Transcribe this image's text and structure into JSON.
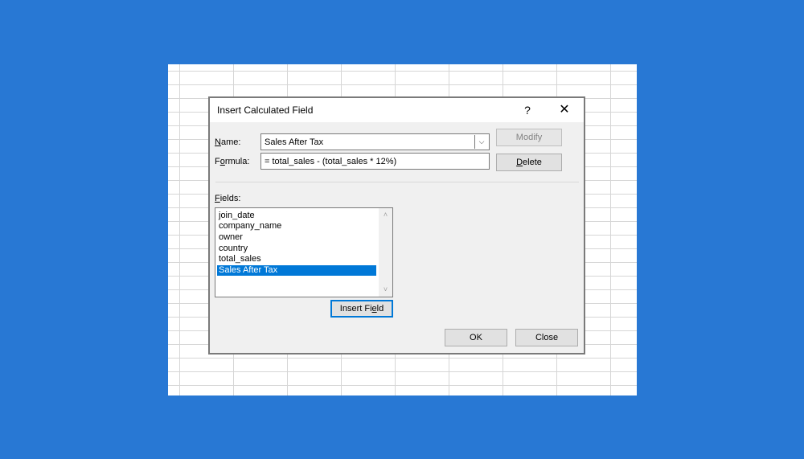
{
  "dialog": {
    "title": "Insert Calculated Field",
    "help_glyph": "?",
    "close_glyph": "✕"
  },
  "name": {
    "label": "Name:",
    "value": "Sales After Tax",
    "dropdown_glyph": "⌵"
  },
  "formula": {
    "label": "Formula:",
    "value": "= total_sales - (total_sales * 12%)"
  },
  "buttons": {
    "modify": "Modify",
    "delete": "Delete",
    "insert_field": "Insert Field",
    "ok": "OK",
    "close": "Close"
  },
  "fields": {
    "label": "Fields:",
    "items": [
      "join_date",
      "company_name",
      "owner",
      "country",
      "total_sales",
      "Sales After Tax"
    ],
    "selected": "Sales After Tax"
  },
  "scrollbar": {
    "up_glyph": "˄",
    "down_glyph": "˅"
  },
  "colors": {
    "background": "#2878d4",
    "selection": "#0078d7"
  }
}
